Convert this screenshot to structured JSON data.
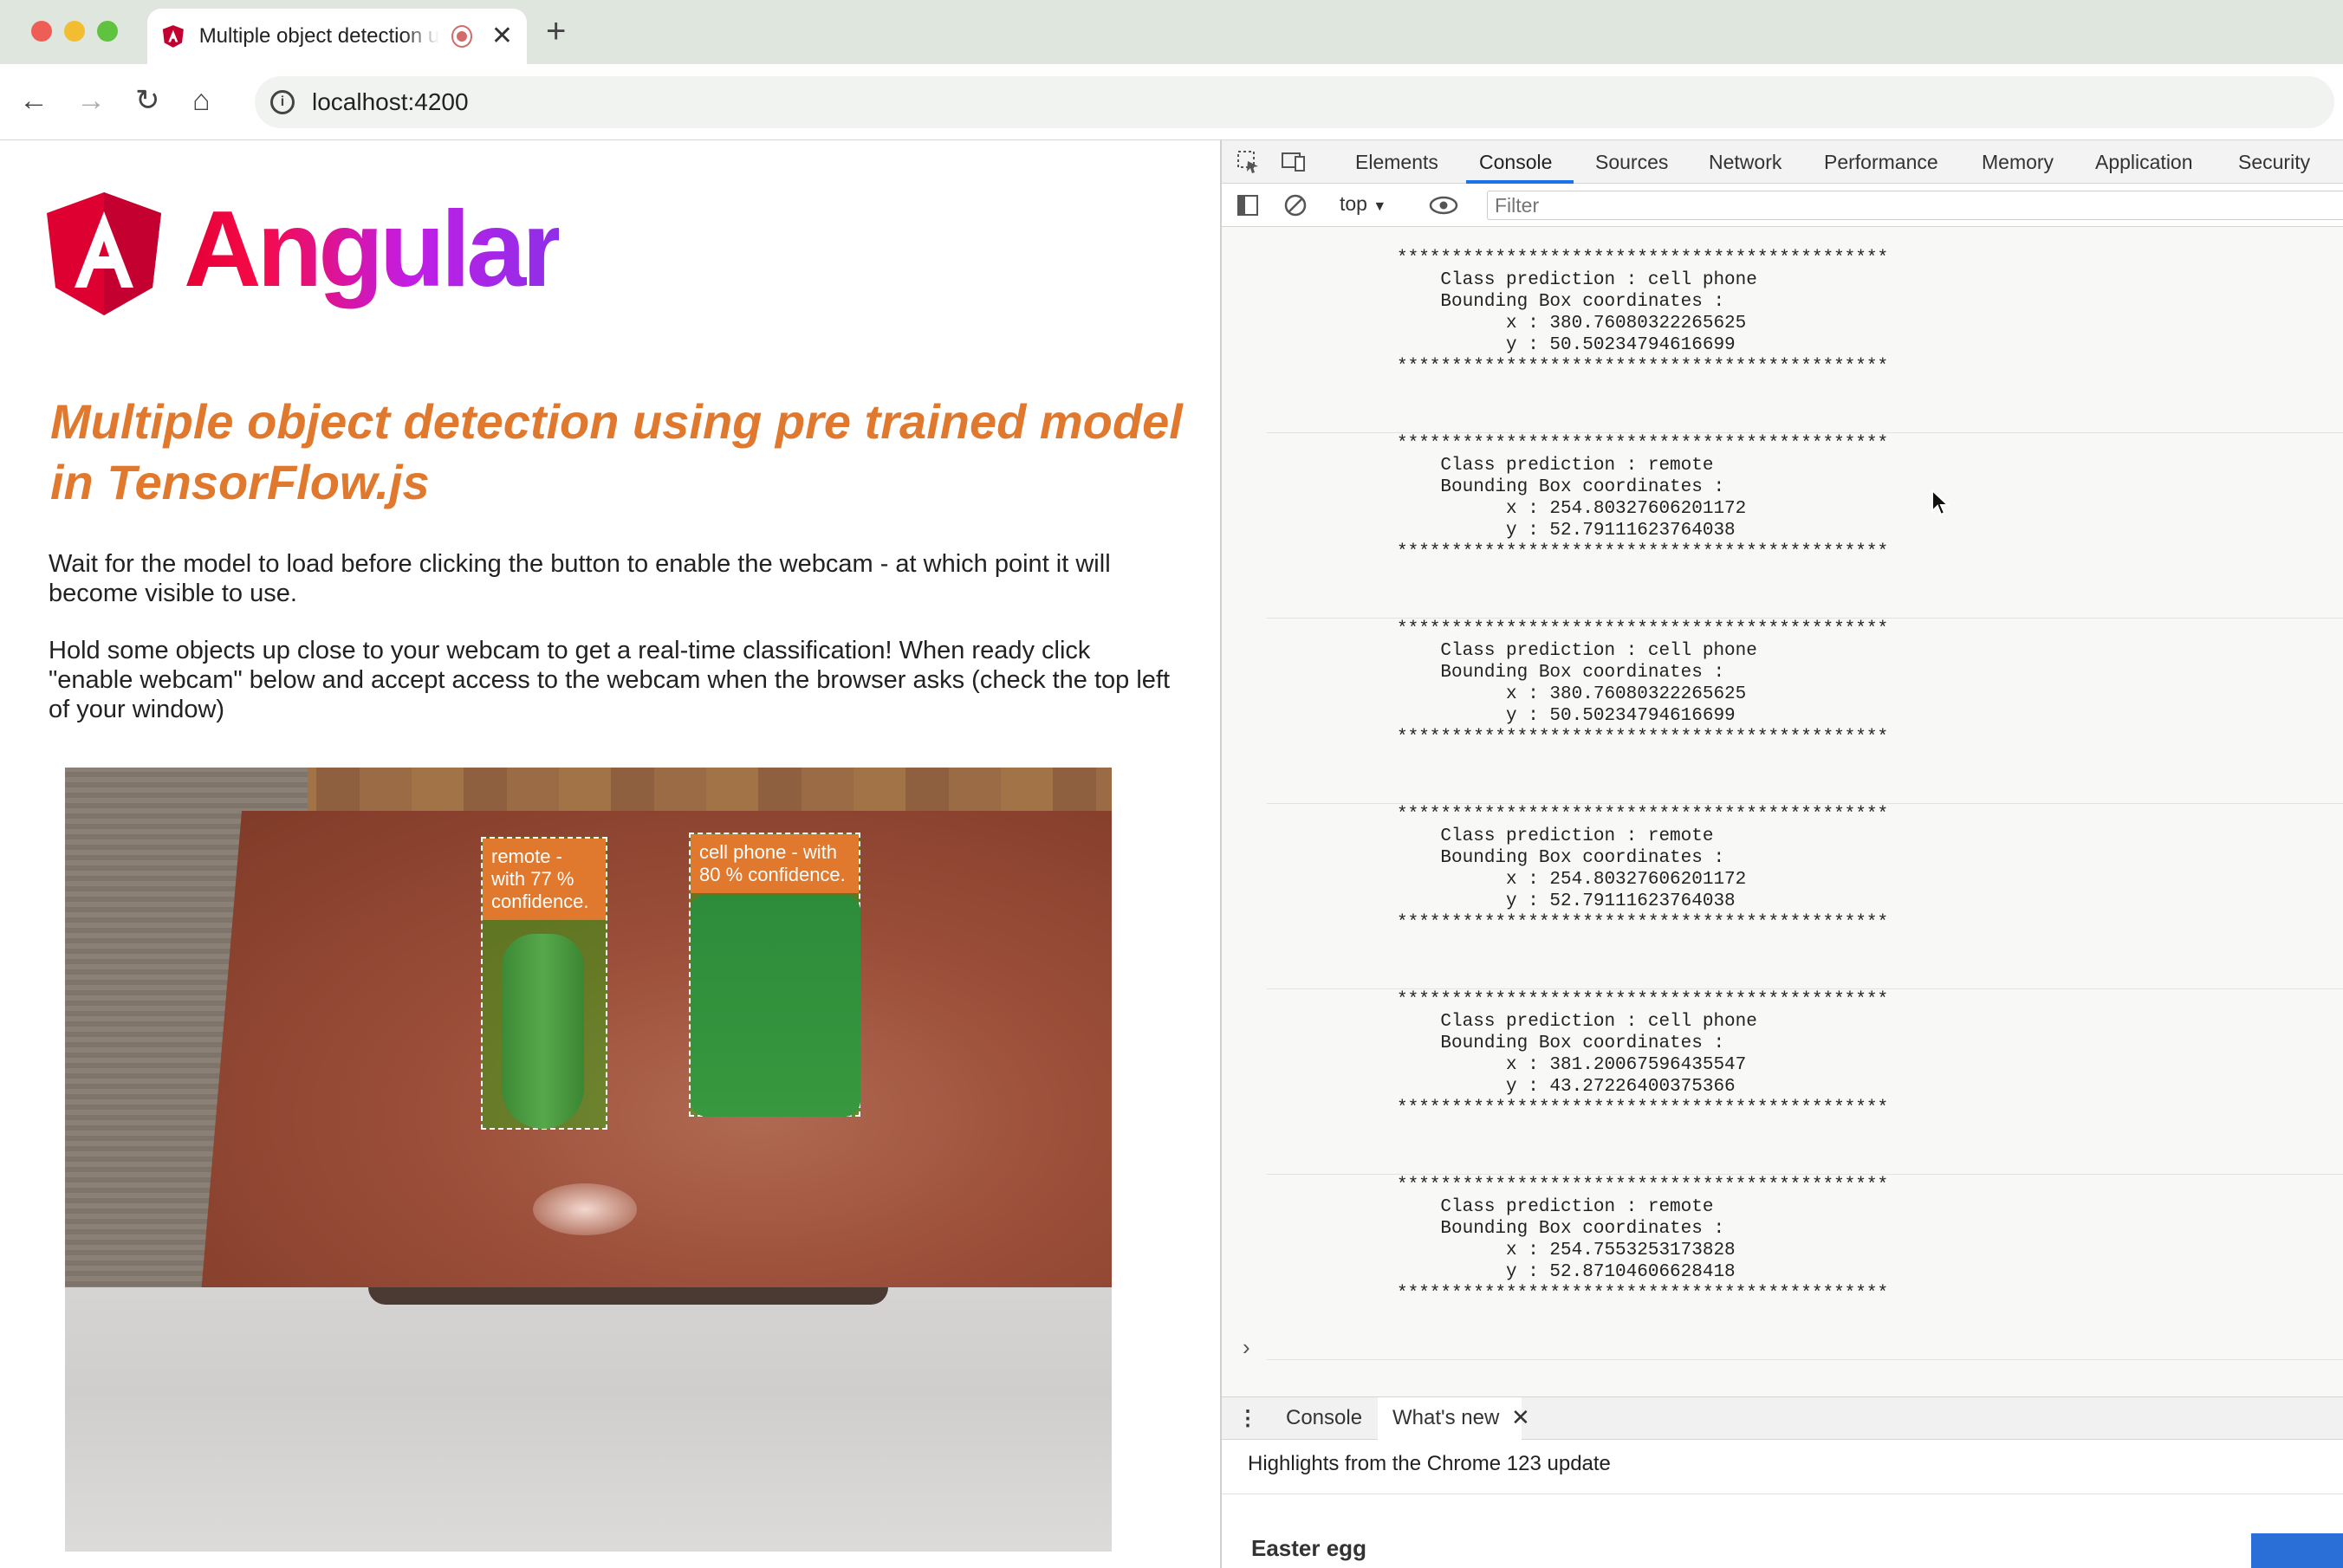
{
  "browser": {
    "tab_title": "Multiple object detection u",
    "url": "localhost:4200"
  },
  "page": {
    "logo_text": "Angular",
    "heading": "Multiple object detection using pre trained model in TensorFlow.js",
    "para1": "Wait for the model to load before clicking the button to enable the webcam - at which point it will become visible to use.",
    "para2": "Hold some objects up close to your webcam to get a real-time classification! When ready click \"enable webcam\" below and accept access to the webcam when the browser asks (check the top left of your window)",
    "detections": [
      {
        "label": "remote - with 77 % confidence."
      },
      {
        "label": "cell phone - with 80 % confidence."
      }
    ]
  },
  "devtools": {
    "tabs": [
      "Elements",
      "Console",
      "Sources",
      "Network",
      "Performance",
      "Memory",
      "Application",
      "Security"
    ],
    "active_tab": "Console",
    "context": "top",
    "filter_placeholder": "Filter",
    "logs": [
      {
        "cls": "cell phone",
        "x": "380.76080322265625",
        "y": "50.50234794616699"
      },
      {
        "cls": "remote",
        "x": "254.80327606201172",
        "y": "52.79111623764038"
      },
      {
        "cls": "cell phone",
        "x": "380.76080322265625",
        "y": "50.50234794616699"
      },
      {
        "cls": "remote",
        "x": "254.80327606201172",
        "y": "52.79111623764038"
      },
      {
        "cls": "cell phone",
        "x": "381.20067596435547",
        "y": "43.27226400375366"
      },
      {
        "cls": "remote",
        "x": "254.7553253173828",
        "y": "52.87104606628418"
      }
    ],
    "drawer_tabs": [
      "Console",
      "What's new"
    ],
    "highlights": "Highlights from the Chrome 123 update",
    "easter_egg": "Easter egg"
  }
}
